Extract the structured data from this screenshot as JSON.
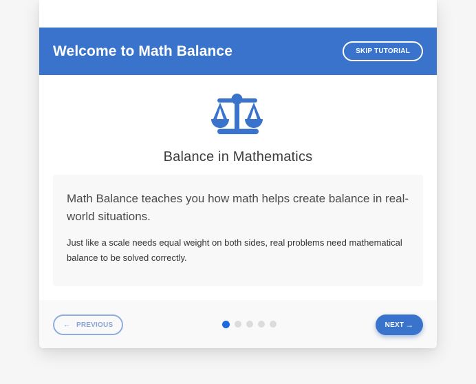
{
  "header": {
    "title": "Welcome to Math Balance",
    "skip_label": "SKIP TUTORIAL"
  },
  "step": {
    "icon": "balance-scale-icon",
    "title": "Balance in Mathematics",
    "lead": "Math Balance teaches you how math helps create balance in real-world situations.",
    "detail": "Just like a scale needs equal weight on both sides, real problems need mathematical balance to be solved correctly."
  },
  "footer": {
    "previous_label": "PREVIOUS",
    "next_label": "NEXT",
    "total_steps": 5,
    "current_step": 1
  },
  "colors": {
    "accent": "#3a73cc",
    "active_dot": "#1a6be0",
    "inactive_dot": "#dcdcdc"
  }
}
